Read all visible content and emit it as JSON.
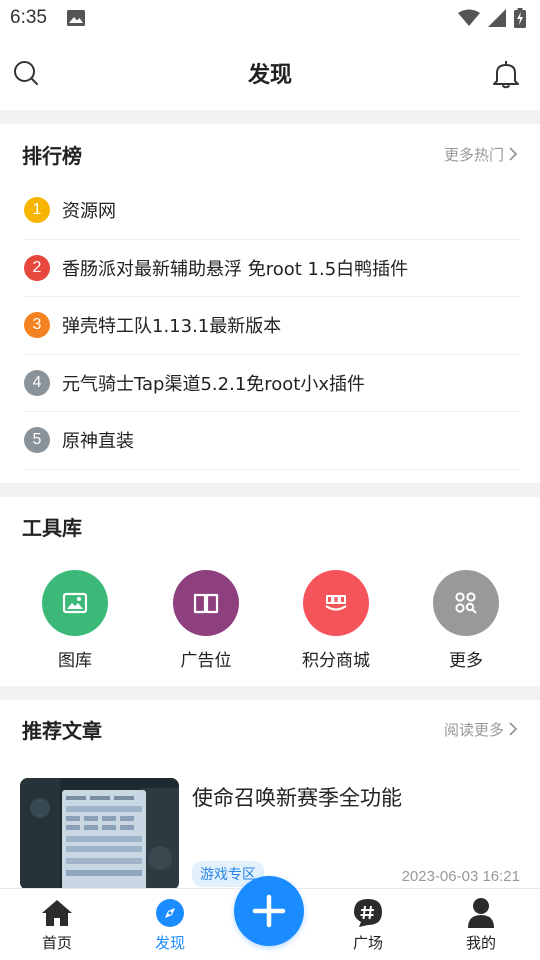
{
  "status_bar": {
    "time": "6:35"
  },
  "header": {
    "title": "发现"
  },
  "ranking": {
    "title": "排行榜",
    "more": "更多热门",
    "items": [
      {
        "rank": "1",
        "label": "资源网",
        "color": "#f7b500"
      },
      {
        "rank": "2",
        "label": "香肠派对最新辅助悬浮 免root 1.5白鸭插件",
        "color": "#e8473d"
      },
      {
        "rank": "3",
        "label": "弹壳特工队1.13.1最新版本",
        "color": "#f58220"
      },
      {
        "rank": "4",
        "label": "元气骑士Tap渠道5.2.1免root小x插件",
        "color": "#8a9399"
      },
      {
        "rank": "5",
        "label": "原神直装",
        "color": "#8a9399"
      }
    ]
  },
  "tools": {
    "title": "工具库",
    "items": [
      {
        "label": "图库",
        "icon": "gallery-icon",
        "color": "#3cb878"
      },
      {
        "label": "广告位",
        "icon": "book-icon",
        "color": "#8e3f7e"
      },
      {
        "label": "积分商城",
        "icon": "store-icon",
        "color": "#f5545a"
      },
      {
        "label": "更多",
        "icon": "apps-icon",
        "color": "#999999"
      }
    ]
  },
  "articles": {
    "title": "推荐文章",
    "more": "阅读更多",
    "items": [
      {
        "title": "使命召唤新赛季全功能",
        "tag": "游戏专区",
        "date": "2023-06-03 16:21"
      }
    ]
  },
  "bottom_nav": {
    "items": [
      {
        "label": "首页",
        "icon": "home-icon"
      },
      {
        "label": "发现",
        "icon": "compass-icon",
        "active": true
      },
      {
        "label": "广场",
        "icon": "hashtag-chat-icon"
      },
      {
        "label": "我的",
        "icon": "user-icon"
      }
    ],
    "fab_icon": "plus-icon",
    "accent": "#1a8cff"
  }
}
